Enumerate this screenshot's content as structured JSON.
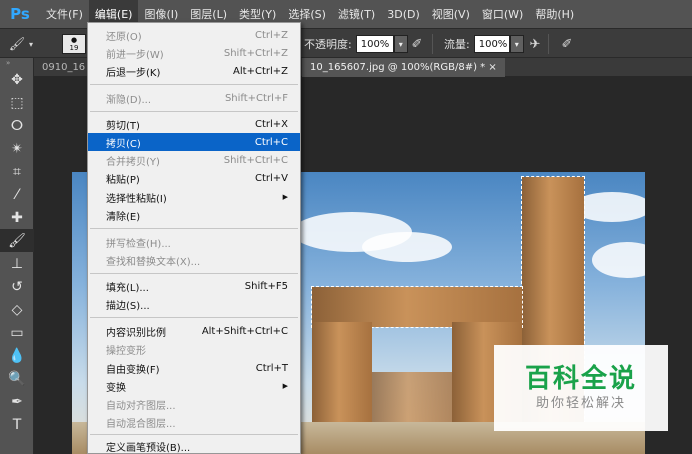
{
  "menubar": {
    "logo": "Ps",
    "items": [
      "文件(F)",
      "编辑(E)",
      "图像(I)",
      "图层(L)",
      "类型(Y)",
      "选择(S)",
      "滤镜(T)",
      "3D(D)",
      "视图(V)",
      "窗口(W)",
      "帮助(H)"
    ],
    "active_item": "编辑(E)"
  },
  "options_bar": {
    "brush_size": "19",
    "opacity_label": "不透明度:",
    "opacity_value": "100%",
    "flow_label": "流量:",
    "flow_value": "100%"
  },
  "tabs": [
    {
      "label": "0910_16"
    },
    {
      "label": "10_165607.jpg @ 100%(RGB/8#) * ×"
    }
  ],
  "edit_menu": {
    "items": [
      {
        "label": "还原(O)",
        "shortcut": "Ctrl+Z",
        "disabled": true
      },
      {
        "label": "前进一步(W)",
        "shortcut": "Shift+Ctrl+Z",
        "disabled": true
      },
      {
        "label": "后退一步(K)",
        "shortcut": "Alt+Ctrl+Z",
        "disabled": false
      },
      {
        "label": "渐隐(D)...",
        "shortcut": "Shift+Ctrl+F",
        "disabled": true
      },
      {
        "label": "剪切(T)",
        "shortcut": "Ctrl+X",
        "disabled": false
      },
      {
        "label": "拷贝(C)",
        "shortcut": "Ctrl+C",
        "disabled": false,
        "highlighted": true
      },
      {
        "label": "合并拷贝(Y)",
        "shortcut": "Shift+Ctrl+C",
        "disabled": true
      },
      {
        "label": "粘贴(P)",
        "shortcut": "Ctrl+V",
        "disabled": false
      },
      {
        "label": "选择性粘贴(I)",
        "shortcut": "",
        "disabled": false,
        "submenu": true
      },
      {
        "label": "清除(E)",
        "shortcut": "",
        "disabled": false
      },
      {
        "label": "拼写检查(H)...",
        "shortcut": "",
        "disabled": true
      },
      {
        "label": "查找和替换文本(X)...",
        "shortcut": "",
        "disabled": true
      },
      {
        "label": "填充(L)...",
        "shortcut": "Shift+F5",
        "disabled": false
      },
      {
        "label": "描边(S)...",
        "shortcut": "",
        "disabled": false
      },
      {
        "label": "内容识别比例",
        "shortcut": "Alt+Shift+Ctrl+C",
        "disabled": false
      },
      {
        "label": "操控变形",
        "shortcut": "",
        "disabled": true
      },
      {
        "label": "自由变换(F)",
        "shortcut": "Ctrl+T",
        "disabled": false
      },
      {
        "label": "变换",
        "shortcut": "",
        "disabled": false,
        "submenu": true
      },
      {
        "label": "自动对齐图层...",
        "shortcut": "",
        "disabled": true
      },
      {
        "label": "自动混合图层...",
        "shortcut": "",
        "disabled": true
      },
      {
        "label": "定义画笔预设(B)...",
        "shortcut": "",
        "disabled": false
      }
    ]
  },
  "watermark": {
    "title": "百科全说",
    "subtitle": "助你轻松解决"
  },
  "colors": {
    "menu_highlight": "#0a64c8",
    "watermark_green": "#1aa24a",
    "ps_blue": "#31a8ff"
  }
}
